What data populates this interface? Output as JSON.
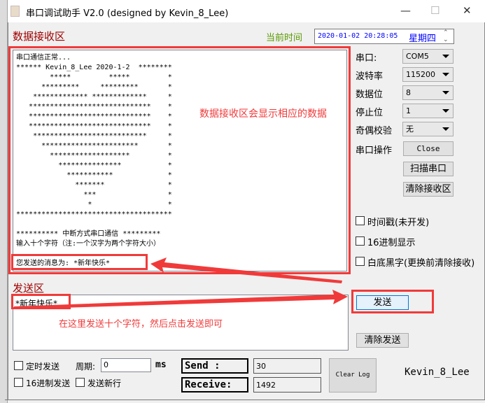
{
  "window": {
    "title": "串口调试助手 V2.0  (designed by Kevin_8_Lee)",
    "minimize": "—",
    "maximize": "☐",
    "close": "✕"
  },
  "receive": {
    "label": "数据接收区",
    "lines": [
      "串口通信正常...",
      "****** Kevin_8_Lee 2020-1-2  ********",
      "        *****         *****         *",
      "      *********     *********       *",
      "    ************* *************     *",
      "   *****************************    *",
      "   *****************************    *",
      "   *****************************    *",
      "    ***************************     *",
      "      ***********************       *",
      "        *******************         *",
      "          ***************           *",
      "            ***********             *",
      "              *******               *",
      "                ***                 *",
      "                 *                  *",
      "*************************************",
      "",
      "********** 中断方式串口通信 *********",
      "输入十个字符（注:一个汉字为两个字符大小）",
      "",
      "您发送的消息为: *新年快乐*"
    ],
    "annotation": "数据接收区会显示相应的数据"
  },
  "clock": {
    "label": "当前时间",
    "value": "2020-01-02 20:28:05 ",
    "weekday": "星期四"
  },
  "settings": [
    {
      "label": "串口:",
      "value": "COM5"
    },
    {
      "label": "波特率",
      "value": "115200"
    },
    {
      "label": "数据位",
      "value": "8"
    },
    {
      "label": "停止位",
      "value": "1"
    },
    {
      "label": "奇偶校验",
      "value": "无"
    }
  ],
  "port_op": {
    "label": "串口操作",
    "close": "Close",
    "scan": "扫描串口",
    "clear_receive": "清除接收区"
  },
  "options": [
    "时间戳(未开发)",
    "16进制显示",
    "白底黑字(更换前清除接收)"
  ],
  "send": {
    "label": "发送区",
    "value": "*新年快乐*",
    "annotation": "在这里发送十个字符，然后点击发送即可",
    "send_button": "发送",
    "clear_button": "清除发送"
  },
  "bottom": {
    "timed_send": "定时发送",
    "period_label": "周期:",
    "period_value": "0",
    "ms": "ms",
    "hex_send": "16进制发送",
    "send_newline": "发送新行",
    "send_count_label": "Send :",
    "send_count": "30",
    "receive_count_label": "Receive:",
    "receive_count": "1492",
    "clear_log": "Clear Log",
    "author": "Kevin_8_Lee"
  },
  "colors": {
    "annotation": "#f03a3a",
    "label_red": "#a00000",
    "clock_label": "#5a9a00",
    "clock_text": "#0000ff",
    "send_btn_bg": "#e5f1fb",
    "send_btn_border": "#0078d7"
  }
}
